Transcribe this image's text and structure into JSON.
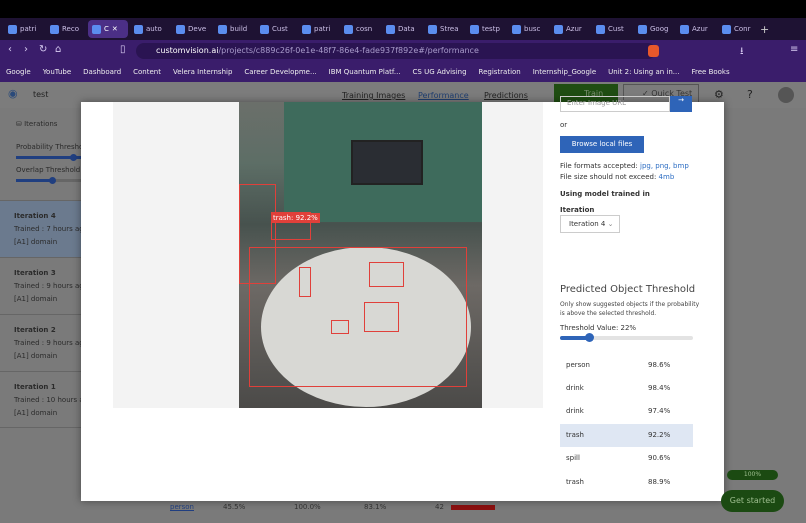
{
  "browser": {
    "tabs": [
      "patri",
      "Reco",
      "C",
      "auto",
      "Deve",
      "build",
      "Cust",
      "patri",
      "cosn",
      "Data",
      "Strea",
      "testp",
      "busc",
      "Azur",
      "Cust",
      "Goog",
      "Azur",
      "Conr"
    ],
    "active_tab": 2,
    "url_domain": "customvision.ai",
    "url_path": "/projects/c889c26f-0e1e-48f7-86e4-fade937f892e#/performance",
    "bookmarks": [
      "Google",
      "YouTube",
      "Dashboard",
      "Content",
      "Velera Internship",
      "Career Developme...",
      "IBM Quantum Platf...",
      "CS UG Advising",
      "Registration",
      "Internship_Google",
      "Unit 2: Using an in...",
      "Free Books"
    ]
  },
  "header": {
    "project": "test",
    "nav": [
      "Training Images",
      "Performance",
      "Predictions"
    ],
    "train": "Train",
    "quick_test": "Quick Test",
    "help": "?"
  },
  "sidebar": {
    "iterations_label": "Iterations",
    "prob_threshold": "Probability Threshold",
    "overlap_threshold": "Overlap Threshold:",
    "iterations": [
      {
        "name": "Iteration 4",
        "trained": "Trained : 7 hours ago",
        "domain": "[A1] domain",
        "selected": true
      },
      {
        "name": "Iteration 3",
        "trained": "Trained : 9 hours ago",
        "domain": "[A1] domain"
      },
      {
        "name": "Iteration 2",
        "trained": "Trained : 9 hours ago",
        "domain": "[A1] domain"
      },
      {
        "name": "Iteration 1",
        "trained": "Trained : 10 hours ago",
        "domain": "[A1] domain"
      }
    ]
  },
  "background_table": {
    "tag": "person",
    "precision": "45.5%",
    "recall": "100.0%",
    "ap": "83.1%",
    "count": "42"
  },
  "modal": {
    "image_label": "trash: 92.2%",
    "url_placeholder": "Enter Image URL",
    "or": "or",
    "browse": "Browse local files",
    "formats_label": "File formats accepted:",
    "formats": "jpg, png, bmp",
    "size_label": "File size should not exceed:",
    "size": "4mb",
    "using_model": "Using model trained in",
    "iteration_label": "Iteration",
    "iteration_value": "Iteration 4",
    "threshold_title": "Predicted Object Threshold",
    "threshold_desc": "Only show suggested objects if the probability is above the selected threshold.",
    "threshold_value_label": "Threshold Value: 22%",
    "threshold_value": 22,
    "predictions": [
      {
        "tag": "person",
        "prob": "98.6%"
      },
      {
        "tag": "drink",
        "prob": "98.4%"
      },
      {
        "tag": "drink",
        "prob": "97.4%"
      },
      {
        "tag": "trash",
        "prob": "92.2%",
        "selected": true
      },
      {
        "tag": "spill",
        "prob": "90.6%"
      },
      {
        "tag": "trash",
        "prob": "88.9%"
      }
    ]
  },
  "progress": "100%",
  "get_started": "Get started"
}
